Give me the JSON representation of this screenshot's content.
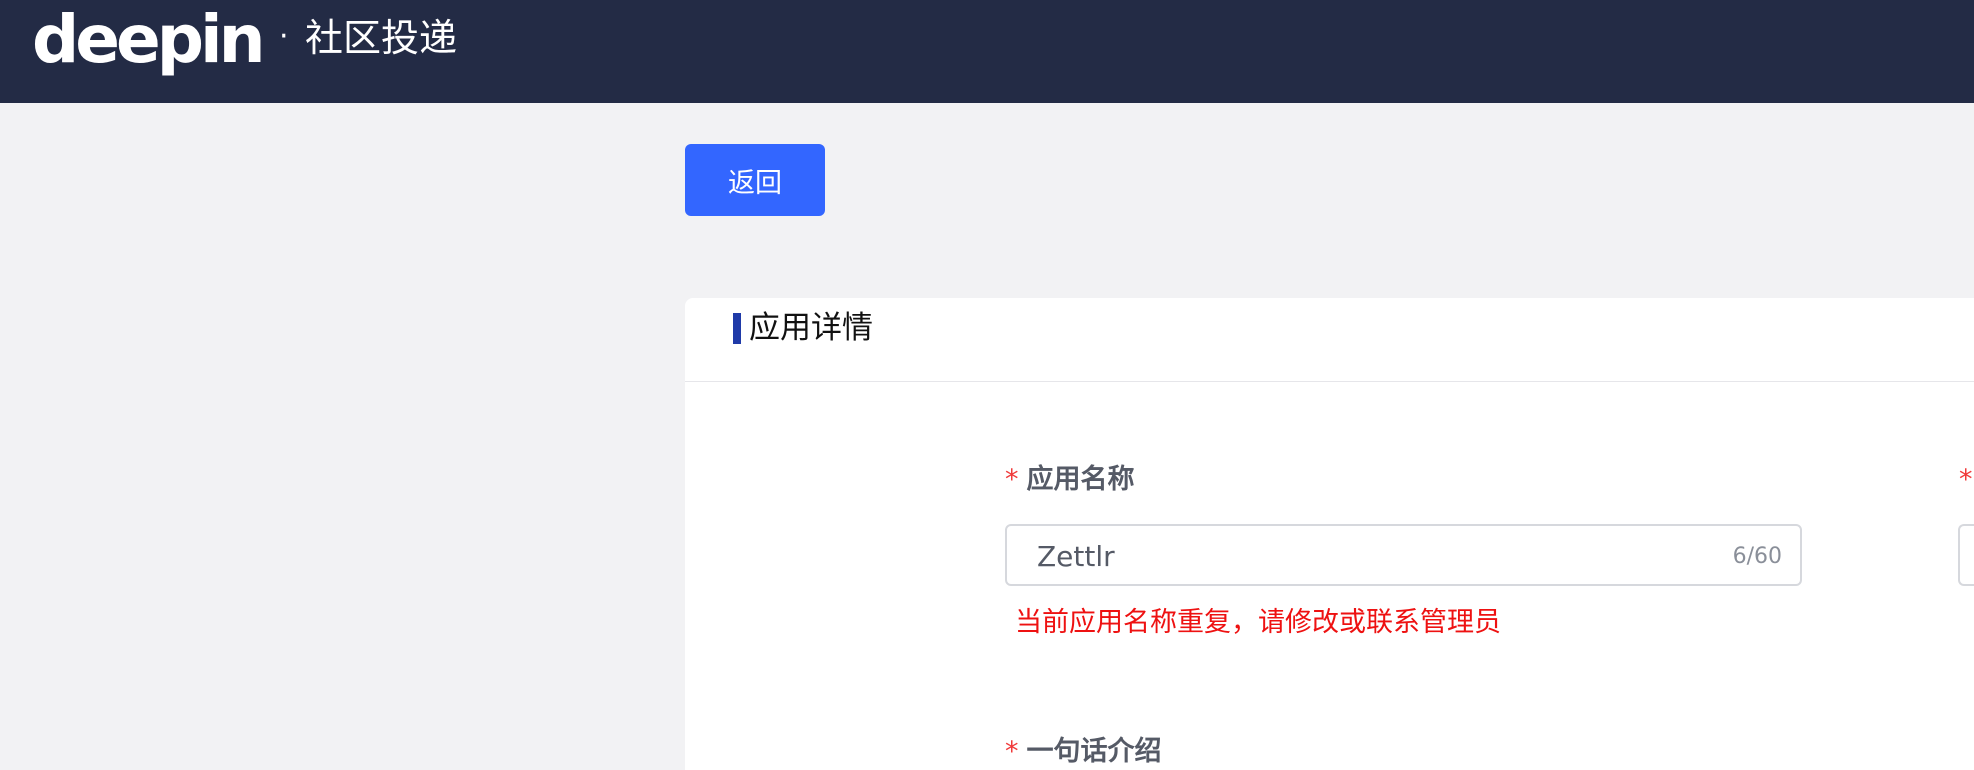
{
  "header": {
    "logo_text": "deepin",
    "separator": "·",
    "site_name": "社区投递"
  },
  "toolbar": {
    "back_label": "返回"
  },
  "card": {
    "title": "应用详情",
    "fields": {
      "app_name": {
        "required_mark": "*",
        "label": "应用名称",
        "value": "Zettlr",
        "counter": "6/60",
        "error": "当前应用名称重复，请修改或联系管理员"
      },
      "one_line_intro": {
        "required_mark": "*",
        "label": "一句话介绍"
      },
      "right_column": {
        "required_mark": "*"
      }
    }
  },
  "colors": {
    "header_bg": "#232b45",
    "accent": "#3366ff",
    "error": "#ee1111",
    "required": "#f03a3a"
  }
}
